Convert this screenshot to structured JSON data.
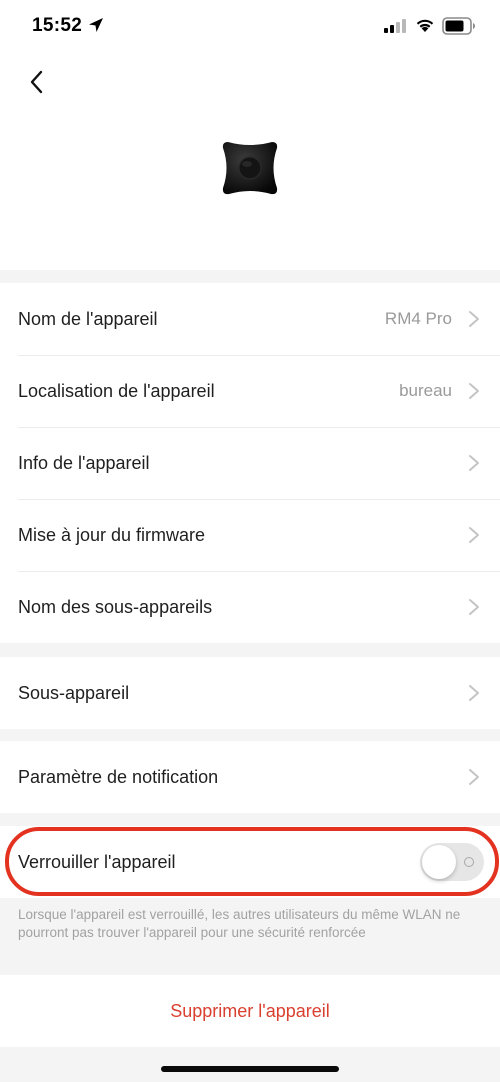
{
  "status_bar": {
    "time": "15:52"
  },
  "header": {
    "back_icon": "chevron-left-icon",
    "device_image": "broadlink-rm4-pro-device"
  },
  "device_settings": [
    {
      "label": "Nom de l'appareil",
      "value": "RM4 Pro"
    },
    {
      "label": "Localisation de l'appareil",
      "value": "bureau"
    },
    {
      "label": "Info de l'appareil",
      "value": ""
    },
    {
      "label": "Mise à jour du firmware",
      "value": ""
    },
    {
      "label": "Nom des sous-appareils",
      "value": ""
    }
  ],
  "sub_device": {
    "label": "Sous-appareil"
  },
  "notification": {
    "label": "Paramètre de notification"
  },
  "lock": {
    "label": "Verrouiller l'appareil",
    "enabled": false,
    "hint": "Lorsque l'appareil est verrouillé, les autres utilisateurs du même WLAN ne pourront pas trouver l'appareil pour une sécurité renforcée"
  },
  "delete": {
    "label": "Supprimer l'appareil"
  },
  "colors": {
    "highlight": "#e3321f",
    "danger_text": "#d9402f",
    "background": "#f4f4f4"
  }
}
